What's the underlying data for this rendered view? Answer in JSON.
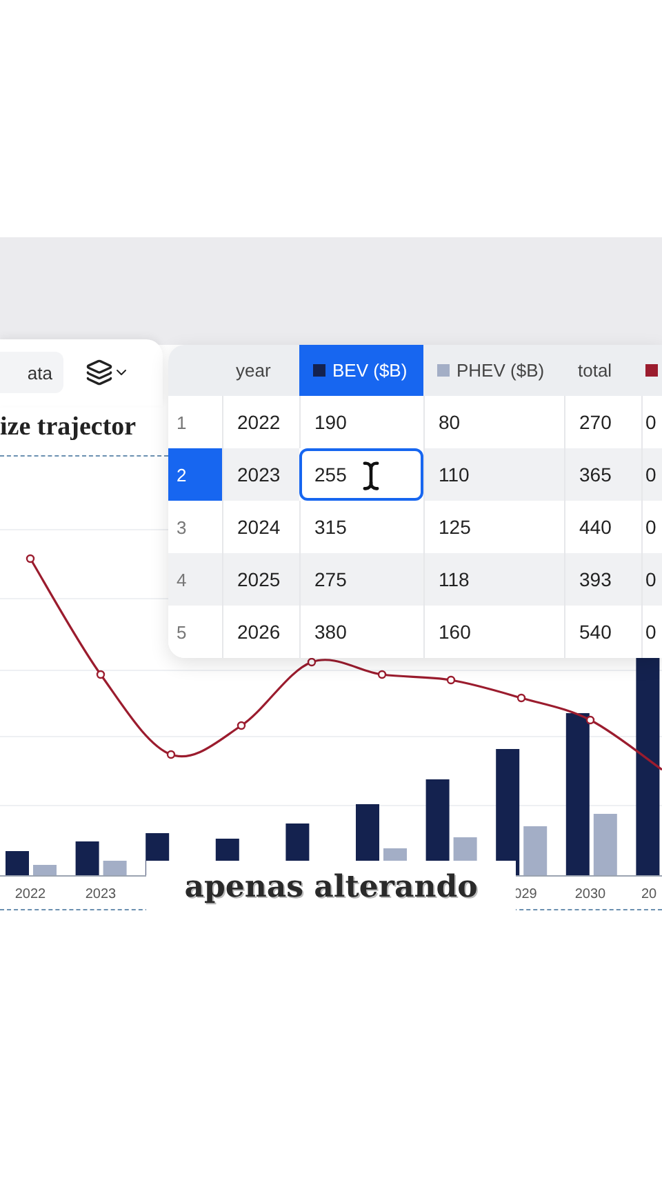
{
  "toolbar": {
    "data_button": "ata",
    "layers_menu": {
      "expanded": false
    }
  },
  "title": "ize trajector",
  "table": {
    "columns": [
      {
        "kind": "plain",
        "label": "year",
        "selected": false
      },
      {
        "kind": "series",
        "label": "BEV ($B)",
        "color": "#14224f",
        "selected": true
      },
      {
        "kind": "series",
        "label": "PHEV ($B)",
        "color": "#a3aec6",
        "selected": false
      },
      {
        "kind": "plain",
        "label": "total",
        "selected": false
      },
      {
        "kind": "swatch",
        "color": "#9b1c2e",
        "selected": false
      }
    ],
    "rows": [
      {
        "index": "1",
        "selected": false,
        "editing": false,
        "cells": [
          "2022",
          "190",
          "80",
          "270",
          "0"
        ]
      },
      {
        "index": "2",
        "selected": true,
        "editing": true,
        "cells": [
          "2023",
          "255",
          "110",
          "365",
          "0"
        ]
      },
      {
        "index": "3",
        "selected": false,
        "editing": false,
        "cells": [
          "2024",
          "315",
          "125",
          "440",
          "0"
        ]
      },
      {
        "index": "4",
        "selected": false,
        "editing": false,
        "cells": [
          "2025",
          "275",
          "118",
          "393",
          "0"
        ]
      },
      {
        "index": "5",
        "selected": false,
        "editing": false,
        "cells": [
          "2026",
          "380",
          "160",
          "540",
          "0"
        ]
      }
    ]
  },
  "chart": {
    "x_labels": [
      "2022",
      "2023",
      "029",
      "2030",
      "20"
    ]
  },
  "caption": "apenas alterando"
}
